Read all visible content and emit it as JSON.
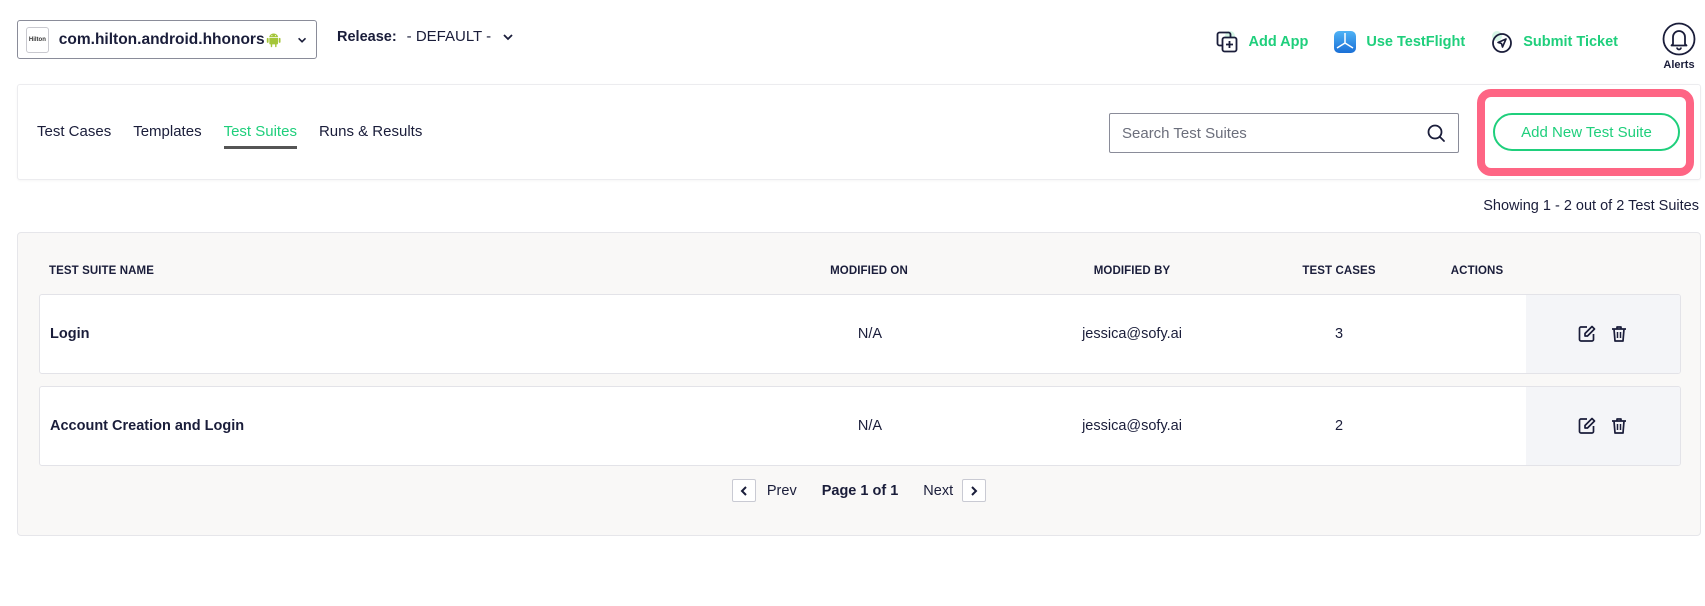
{
  "header": {
    "app_selector": {
      "logo_text": "Hilton",
      "app_name": "com.hilton.android.hhonors",
      "platform_icon": "android-icon"
    },
    "release": {
      "label": "Release:",
      "value": "- DEFAULT -"
    },
    "actions": [
      {
        "label": "Add App",
        "icon": "add-app-icon"
      },
      {
        "label": "Use TestFlight",
        "icon": "testflight-icon"
      },
      {
        "label": "Submit Ticket",
        "icon": "send-icon"
      }
    ],
    "alerts_label": "Alerts"
  },
  "tabs": [
    {
      "label": "Test Cases",
      "active": false
    },
    {
      "label": "Templates",
      "active": false
    },
    {
      "label": "Test Suites",
      "active": true
    },
    {
      "label": "Runs & Results",
      "active": false
    }
  ],
  "search": {
    "placeholder": "Search Test Suites",
    "value": ""
  },
  "add_button_label": "Add New Test Suite",
  "showing_text": "Showing 1 - 2 out of 2 Test Suites",
  "table": {
    "columns": [
      "TEST SUITE NAME",
      "MODIFIED ON",
      "MODIFIED BY",
      "TEST CASES",
      "ACTIONS"
    ],
    "rows": [
      {
        "name": "Login",
        "modified_on": "N/A",
        "modified_by": "jessica@sofy.ai",
        "test_cases": "3"
      },
      {
        "name": "Account Creation and Login",
        "modified_on": "N/A",
        "modified_by": "jessica@sofy.ai",
        "test_cases": "2"
      }
    ]
  },
  "pagination": {
    "prev_label": "Prev",
    "page_info": "Page 1 of 1",
    "next_label": "Next"
  },
  "colors": {
    "accent_green": "#1fcf7c",
    "highlight_pink": "#fe6584",
    "text_dark": "#1a1d3a"
  }
}
